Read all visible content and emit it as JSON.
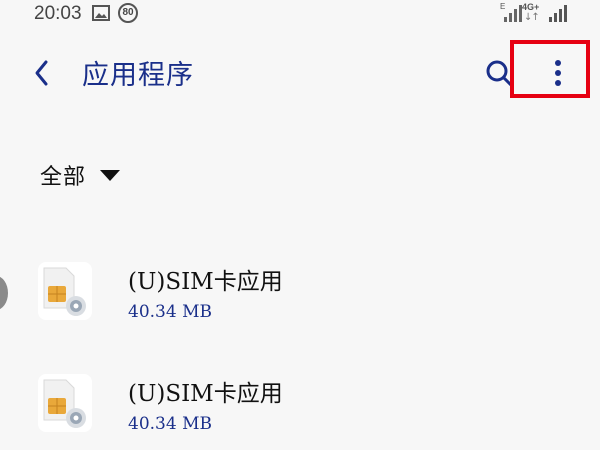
{
  "status_bar": {
    "time": "20:03",
    "battery_badge": "80",
    "network_small": "E",
    "network_type": "4G+",
    "network_arrows": "↓↑",
    "icons": [
      "gallery-icon",
      "signal-icon",
      "signal-icon"
    ]
  },
  "header": {
    "back_icon": "chevron-left-icon",
    "title": "应用程序",
    "search_icon": "search-icon",
    "more_icon": "more-vertical-icon",
    "accent_color": "#1a2f8a",
    "highlight_color": "#e60012"
  },
  "filter": {
    "label": "全部",
    "icon": "triangle-down-icon"
  },
  "apps": [
    {
      "name": "(U)SIM卡应用",
      "size": "40.34 MB",
      "icon": "sim-settings-icon"
    },
    {
      "name": "(U)SIM卡应用",
      "size": "40.34 MB",
      "icon": "sim-settings-icon"
    }
  ]
}
